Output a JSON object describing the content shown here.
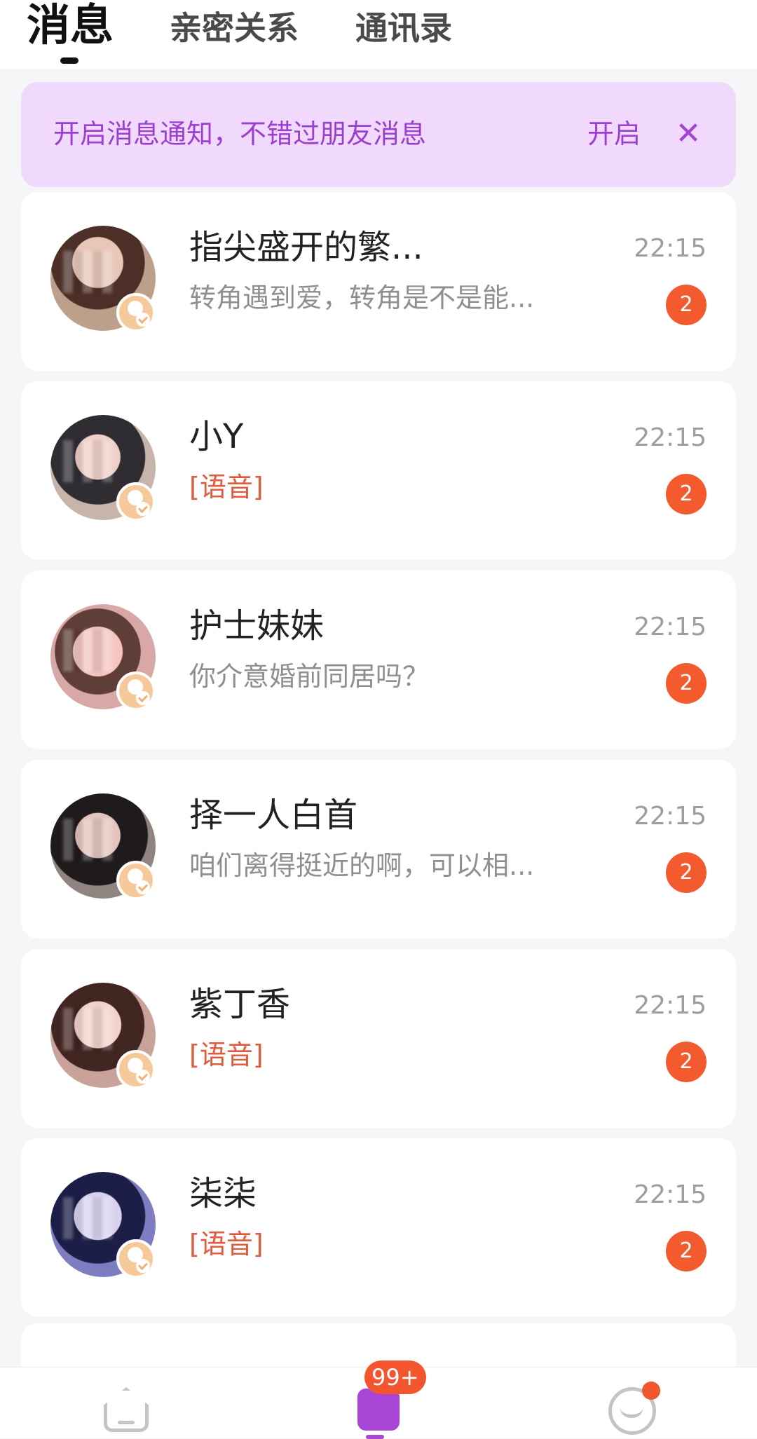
{
  "top_tabs": {
    "messages": "消息",
    "intimate": "亲密关系",
    "contacts": "通讯录"
  },
  "banner": {
    "text": "开启消息通知，不错过朋友消息",
    "action": "开启",
    "close": "✕"
  },
  "conversations": [
    {
      "name": "指尖盛开的繁...",
      "preview": "转角遇到爱，转角是不是能...",
      "time": "22:15",
      "unread": "2",
      "preview_style": "text",
      "avatar_color": "#bda08c"
    },
    {
      "name": "小Y",
      "preview": "[语音]",
      "time": "22:15",
      "unread": "2",
      "preview_style": "voice",
      "avatar_color": "#c7b5ab"
    },
    {
      "name": "护士妹妹",
      "preview": "你介意婚前同居吗？",
      "time": "22:15",
      "unread": "2",
      "preview_style": "text",
      "avatar_color": "#d7a8a6"
    },
    {
      "name": "择一人白首",
      "preview": "咱们离得挺近的啊，可以相...",
      "time": "22:15",
      "unread": "2",
      "preview_style": "text",
      "avatar_color": "#8f8480"
    },
    {
      "name": "紫丁香",
      "preview": "[语音]",
      "time": "22:15",
      "unread": "2",
      "preview_style": "voice",
      "avatar_color": "#c9a39a"
    },
    {
      "name": "柒柒",
      "preview": "[语音]",
      "time": "22:15",
      "unread": "2",
      "preview_style": "voice",
      "avatar_color": "#7f7dc2"
    }
  ],
  "bottom_nav": {
    "messages_count": "99+"
  },
  "icons": {
    "close_banner": "close-icon",
    "home": "home-icon",
    "messages": "chat-icon",
    "profile": "smile-icon",
    "verified": "verified-user-icon"
  },
  "colors": {
    "banner_bg": "#f1d9fb",
    "accent_purple": "#9b3fd0",
    "badge_red": "#f35b2f",
    "voice_red": "#e05a3b"
  }
}
